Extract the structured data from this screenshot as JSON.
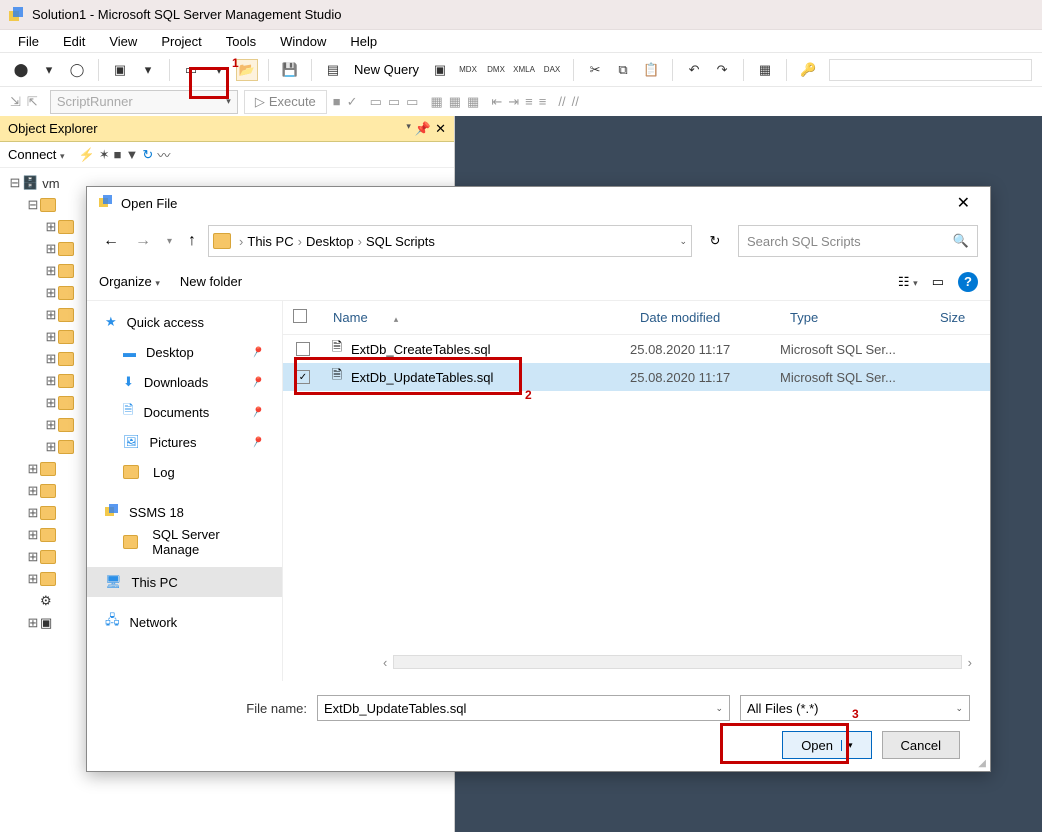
{
  "window": {
    "title": "Solution1 - Microsoft SQL Server Management Studio"
  },
  "menu": [
    "File",
    "Edit",
    "View",
    "Project",
    "Tools",
    "Window",
    "Help"
  ],
  "toolbar": {
    "newQuery": "New Query"
  },
  "toolbar2": {
    "scriptRunner": "ScriptRunner",
    "execute": "Execute"
  },
  "objectExplorer": {
    "title": "Object Explorer",
    "connect": "Connect",
    "root": "vm"
  },
  "dialog": {
    "title": "Open File",
    "breadcrumb": [
      "This PC",
      "Desktop",
      "SQL Scripts"
    ],
    "searchPlaceholder": "Search SQL Scripts",
    "organize": "Organize",
    "newFolder": "New folder",
    "columns": {
      "name": "Name",
      "date": "Date modified",
      "type": "Type",
      "size": "Size"
    },
    "sidebar": {
      "quickAccess": "Quick access",
      "desktop": "Desktop",
      "downloads": "Downloads",
      "documents": "Documents",
      "pictures": "Pictures",
      "log": "Log",
      "ssms": "SSMS 18",
      "sqlmgr": "SQL Server Manage",
      "thispc": "This PC",
      "network": "Network"
    },
    "files": [
      {
        "name": "ExtDb_CreateTables.sql",
        "date": "25.08.2020 11:17",
        "type": "Microsoft SQL Ser...",
        "selected": false,
        "checked": false
      },
      {
        "name": "ExtDb_UpdateTables.sql",
        "date": "25.08.2020 11:17",
        "type": "Microsoft SQL Ser...",
        "selected": true,
        "checked": true
      }
    ],
    "fileNameLabel": "File name:",
    "fileNameValue": "ExtDb_UpdateTables.sql",
    "fileTypeValue": "All Files (*.*)",
    "openBtn": "Open",
    "cancelBtn": "Cancel"
  },
  "annotations": {
    "a1": "1",
    "a2": "2",
    "a3": "3"
  }
}
